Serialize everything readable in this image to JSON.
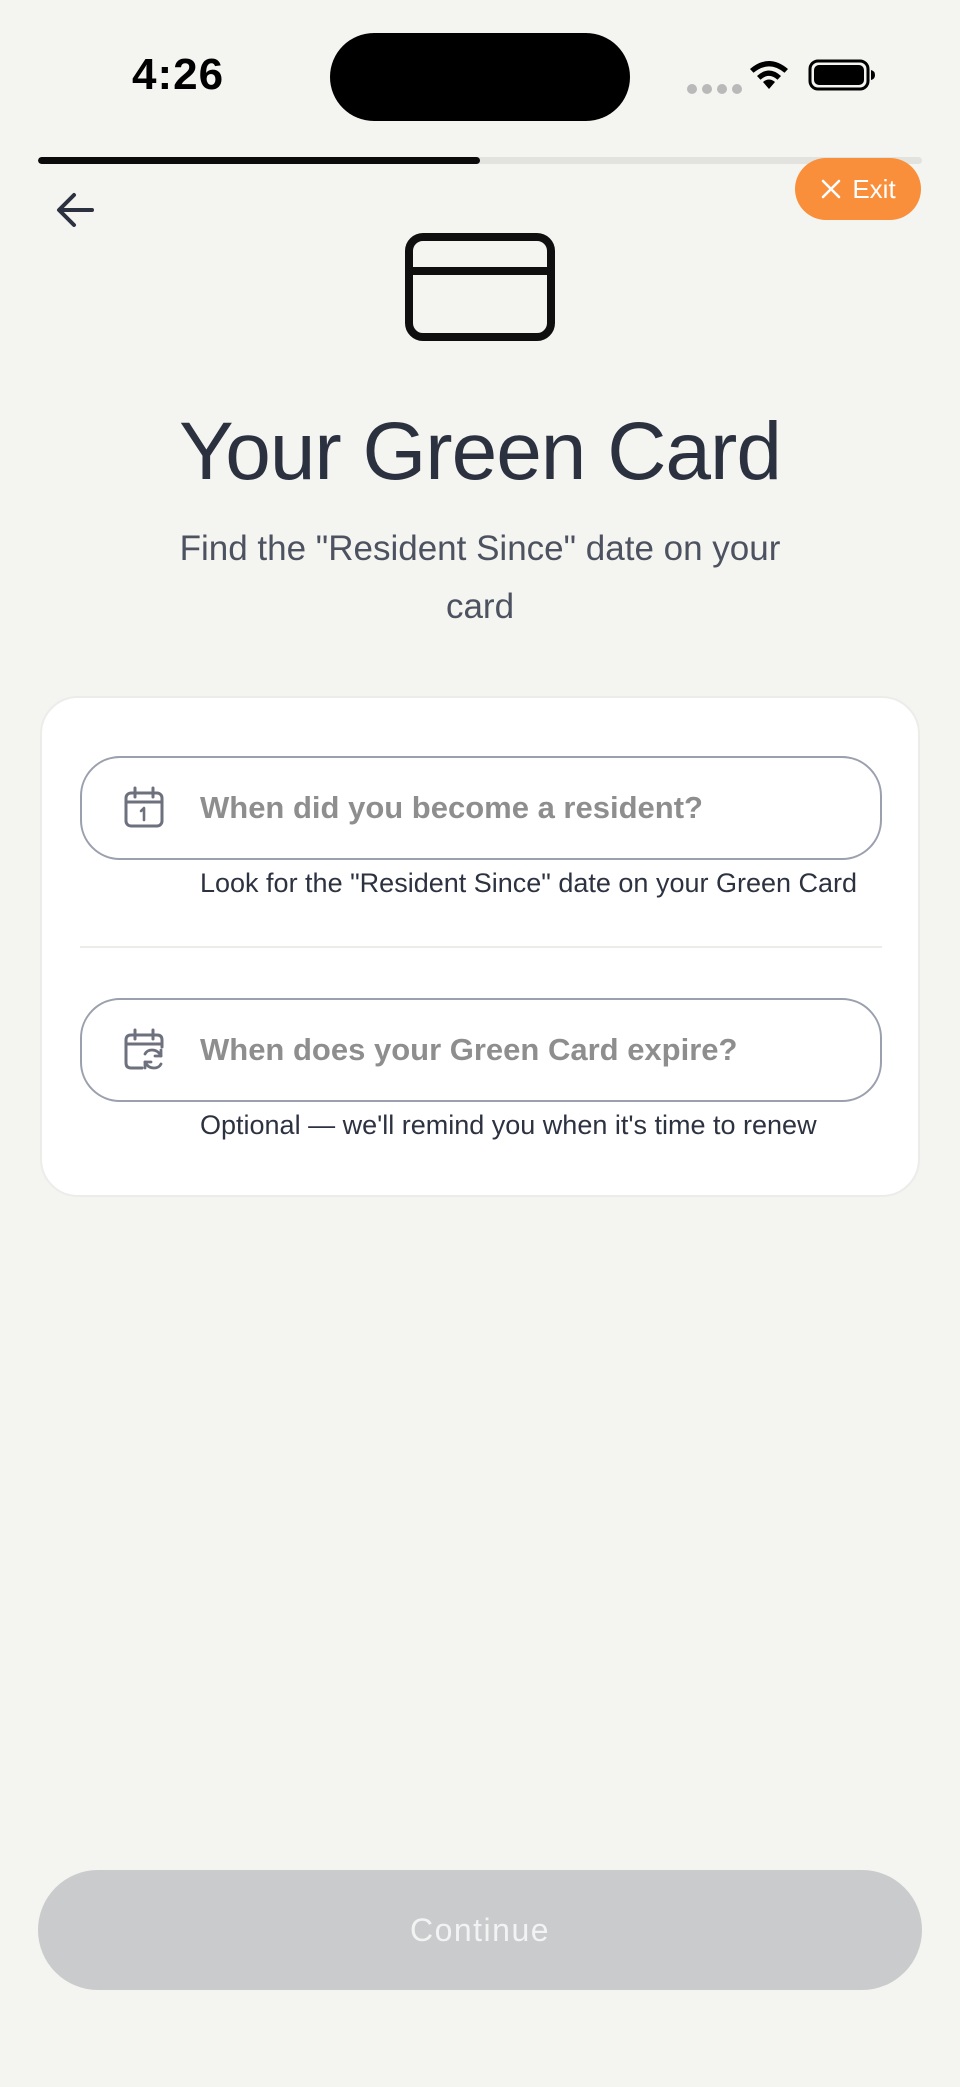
{
  "status_bar": {
    "time": "4:26"
  },
  "progress": {
    "fraction": 0.5
  },
  "nav": {
    "back_icon": "arrow-left-icon",
    "exit_icon": "close-icon",
    "exit_label": "Exit",
    "exit_color": "#f98f3b"
  },
  "hero": {
    "icon": "credit-card-icon",
    "title": "Your Green Card",
    "subtitle": "Find the \"Resident Since\" date on your card"
  },
  "form": {
    "fields": [
      {
        "icon": "calendar-icon",
        "placeholder": "When did you become a resident?",
        "value": "",
        "helper": "Look for the \"Resident Since\" date on your Green Card"
      },
      {
        "icon": "calendar-refresh-icon",
        "placeholder": "When does your Green Card expire?",
        "value": "",
        "helper": "Optional — we'll remind you when it's time to renew"
      }
    ]
  },
  "footer": {
    "continue_label": "Continue",
    "continue_enabled": false
  },
  "colors": {
    "background": "#f4f4f0",
    "accent": "#f98f3b",
    "title": "#2c3140",
    "disabled_button": "#c9cbcd"
  }
}
